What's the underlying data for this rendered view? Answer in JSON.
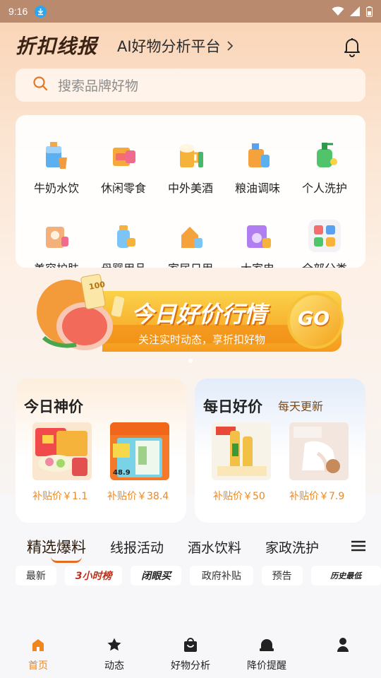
{
  "status_bar": {
    "time": "9:16"
  },
  "header": {
    "brand": "折扣线报",
    "subtitle": "AI好物分析平台",
    "subtitle_arrow": ">"
  },
  "search": {
    "placeholder": "搜索品牌好物"
  },
  "categories": [
    {
      "label": "牛奶水饮",
      "icon": "milk-drink-icon"
    },
    {
      "label": "休闲零食",
      "icon": "snack-icon"
    },
    {
      "label": "中外美酒",
      "icon": "beer-wine-icon"
    },
    {
      "label": "粮油调味",
      "icon": "oil-seasoning-icon"
    },
    {
      "label": "个人洗护",
      "icon": "personal-care-icon"
    },
    {
      "label": "美容护肤",
      "icon": "skincare-icon"
    },
    {
      "label": "母婴用品",
      "icon": "baby-bottle-icon"
    },
    {
      "label": "家居日用",
      "icon": "household-icon"
    },
    {
      "label": "大家电",
      "icon": "appliance-icon"
    },
    {
      "label": "全部分类",
      "icon": "all-categories-icon"
    }
  ],
  "banner": {
    "title": "今日好价行情",
    "subtitle": "关注实时动态，享折扣好物",
    "go_label": "GO",
    "coupon_value": "100"
  },
  "deals": [
    {
      "title": "今日神价",
      "subtitle": "",
      "items": [
        {
          "price": "补贴价￥1.1"
        },
        {
          "price": "补贴价￥38.4",
          "tag": "48.9"
        }
      ]
    },
    {
      "title": "每日好价",
      "subtitle": "每天更新",
      "items": [
        {
          "price": "补贴价￥50"
        },
        {
          "price": "补贴价￥7.9"
        }
      ]
    }
  ],
  "feed_tabs": [
    {
      "label": "精选爆料",
      "active": true
    },
    {
      "label": "线报活动"
    },
    {
      "label": "酒水饮料"
    },
    {
      "label": "家政洗护"
    }
  ],
  "chips": [
    {
      "label": "最新"
    },
    {
      "label": "3小时榜"
    },
    {
      "label": "闭眼买"
    },
    {
      "label": "政府补贴"
    },
    {
      "label": "预告"
    },
    {
      "label": "历史最低"
    }
  ],
  "bottom_nav": [
    {
      "label": "首页",
      "icon": "home-icon",
      "active": true
    },
    {
      "label": "动态",
      "icon": "star-icon"
    },
    {
      "label": "好物分析",
      "icon": "shopping-bag-icon"
    },
    {
      "label": "降价提醒",
      "icon": "alarm-icon"
    },
    {
      "label": "",
      "icon": "profile-icon"
    }
  ],
  "colors": {
    "accent": "#f0861e",
    "price": "#e88a2c",
    "brand_text": "#3a2314"
  }
}
